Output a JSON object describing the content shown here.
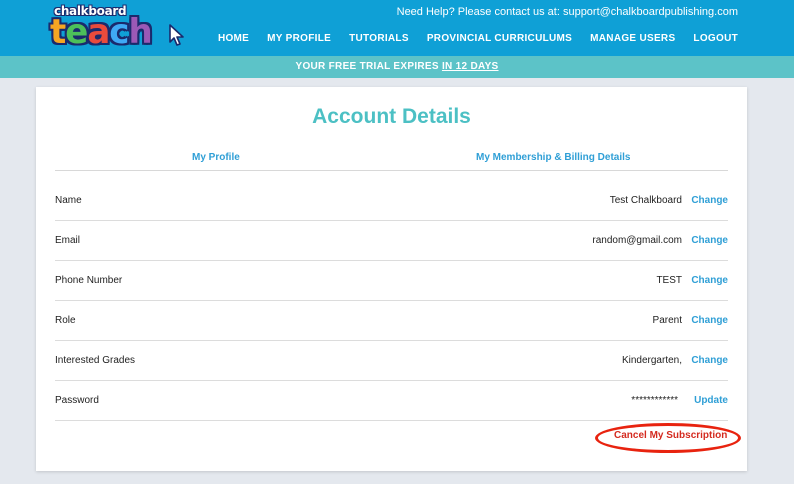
{
  "logo": {
    "small_text": "chalkboard",
    "letters": [
      {
        "ch": "t",
        "color": "#f5a623"
      },
      {
        "ch": "e",
        "color": "#4cc05a"
      },
      {
        "ch": "a",
        "color": "#e94b3c"
      },
      {
        "ch": "c",
        "color": "#3fa9f5"
      },
      {
        "ch": "h",
        "color": "#9b59b6"
      }
    ]
  },
  "header": {
    "help_text": "Need Help? Please contact us at:",
    "support_email": "support@chalkboardpublishing.com",
    "nav": [
      "HOME",
      "MY PROFILE",
      "TUTORIALS",
      "PROVINCIAL CURRICULUMS",
      "MANAGE USERS",
      "LOGOUT"
    ]
  },
  "trial": {
    "prefix": "YOUR FREE TRIAL EXPIRES",
    "days": "IN 12 DAYS"
  },
  "page": {
    "title": "Account Details",
    "tabs": [
      "My Profile",
      "My Membership & Billing Details"
    ]
  },
  "rows": [
    {
      "label": "Name",
      "value": "Test Chalkboard",
      "action": "Change"
    },
    {
      "label": "Email",
      "value": "random@gmail.com",
      "action": "Change"
    },
    {
      "label": "Phone Number",
      "value": "TEST",
      "action": "Change"
    },
    {
      "label": "Role",
      "value": "Parent",
      "action": "Change"
    },
    {
      "label": "Interested Grades",
      "value": "Kindergarten,",
      "action": "Change"
    },
    {
      "label": "Password",
      "value": "************",
      "action": "Update"
    }
  ],
  "cancel_label": "Cancel My Subscription",
  "colors": {
    "header_blue": "#0fa0d6",
    "trial_teal": "#5cc3c8",
    "title_teal": "#4cc0c4",
    "link_blue": "#2f9fd6",
    "cancel_red": "#d42a1f"
  }
}
